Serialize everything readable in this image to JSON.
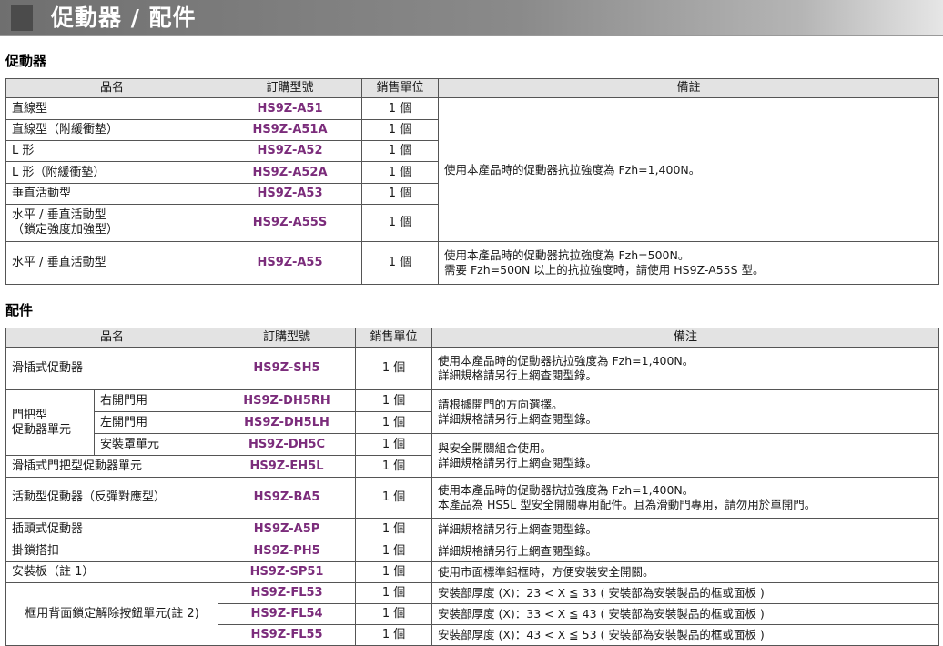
{
  "page": {
    "title": "促動器 / 配件"
  },
  "actuators": {
    "section_title": "促動器",
    "headers": [
      "品名",
      "訂購型號",
      "銷售單位",
      "備註"
    ],
    "rows": [
      {
        "name": "直線型",
        "model": "HS9Z-A51",
        "unit": "1 個"
      },
      {
        "name": "直線型（附緩衝墊）",
        "model": "HS9Z-A51A",
        "unit": "1 個"
      },
      {
        "name": "L 形",
        "model": "HS9Z-A52",
        "unit": "1 個"
      },
      {
        "name": "L 形（附緩衝墊）",
        "model": "HS9Z-A52A",
        "unit": "1 個"
      },
      {
        "name": "垂直活動型",
        "model": "HS9Z-A53",
        "unit": "1 個"
      },
      {
        "name_line1": "水平 / 垂直活動型",
        "name_line2": "（鎖定強度加強型）",
        "model": "HS9Z-A55S",
        "unit": "1 個"
      },
      {
        "name": "水平 / 垂直活動型",
        "model": "HS9Z-A55",
        "unit": "1 個"
      }
    ],
    "note_group1": "使用本產品時的促動器抗拉強度為 Fzh=1,400N。",
    "note_last_line1": "使用本產品時的促動器抗拉強度為 Fzh=500N。",
    "note_last_line2": "需要 Fzh=500N 以上的抗拉強度時，請使用 HS9Z-A55S 型。"
  },
  "accessories": {
    "section_title": "配件",
    "headers": [
      "品名",
      "訂購型號",
      "銷售單位",
      "備注"
    ],
    "slide_actuator": {
      "name": "滑插式促動器",
      "model": "HS9Z-SH5",
      "unit": "1 個",
      "note_line1": "使用本產品時的促動器抗拉強度為 Fzh=1,400N。",
      "note_line2": "詳細規格請另行上網查閱型錄。"
    },
    "handle_unit": {
      "group_line1": "門把型",
      "group_line2": "促動器單元",
      "rows": [
        {
          "sub": "右開門用",
          "model": "HS9Z-DH5RH",
          "unit": "1 個"
        },
        {
          "sub": "左開門用",
          "model": "HS9Z-DH5LH",
          "unit": "1 個"
        },
        {
          "sub": "安裝罩單元",
          "model": "HS9Z-DH5C",
          "unit": "1 個"
        }
      ],
      "note_a_line1": "請根據開門的方向選擇。",
      "note_a_line2": "詳細規格請另行上網查閱型錄。"
    },
    "slide_handle_unit": {
      "name": "滑插式門把型促動器單元",
      "model": "HS9Z-EH5L",
      "unit": "1 個"
    },
    "note_b_line1": "與安全開關組合使用。",
    "note_b_line2": "詳細規格請另行上網查閱型錄。",
    "rebound": {
      "name": "活動型促動器（反彈對應型）",
      "model": "HS9Z-BA5",
      "unit": "1 個",
      "note_line1": "使用本產品時的促動器抗拉強度為 Fzh=1,400N。",
      "note_line2": "本產品為 HS5L 型安全開關專用配件。且為滑動門專用，請勿用於單開門。"
    },
    "plug_actuator": {
      "name": "插頭式促動器",
      "model": "HS9Z-A5P",
      "unit": "1 個",
      "note": "詳細規格請另行上網查閱型錄。"
    },
    "hasp": {
      "name": "掛鎖搭扣",
      "model": "HS9Z-PH5",
      "unit": "1 個",
      "note": "詳細規格請另行上網查閱型錄。"
    },
    "mount_plate": {
      "name": "安裝板（註 1）",
      "model": "HS9Z-SP51",
      "unit": "1 個",
      "note": "使用市面標準鋁框時，方便安裝安全開關。"
    },
    "release_unit": {
      "name": "框用背面鎖定解除按鈕單元(註 2)",
      "rows": [
        {
          "model": "HS9Z-FL53",
          "unit": "1 個",
          "note": "安裝部厚度 (X)：23 < X ≦ 33 ( 安裝部為安裝製品的框或面板 )"
        },
        {
          "model": "HS9Z-FL54",
          "unit": "1 個",
          "note": "安裝部厚度 (X)：33 < X ≦ 43 ( 安裝部為安裝製品的框或面板 )"
        },
        {
          "model": "HS9Z-FL55",
          "unit": "1 個",
          "note": "安裝部厚度 (X)：43 < X ≦ 53 ( 安裝部為安裝製品的框或面板 )"
        }
      ]
    }
  }
}
